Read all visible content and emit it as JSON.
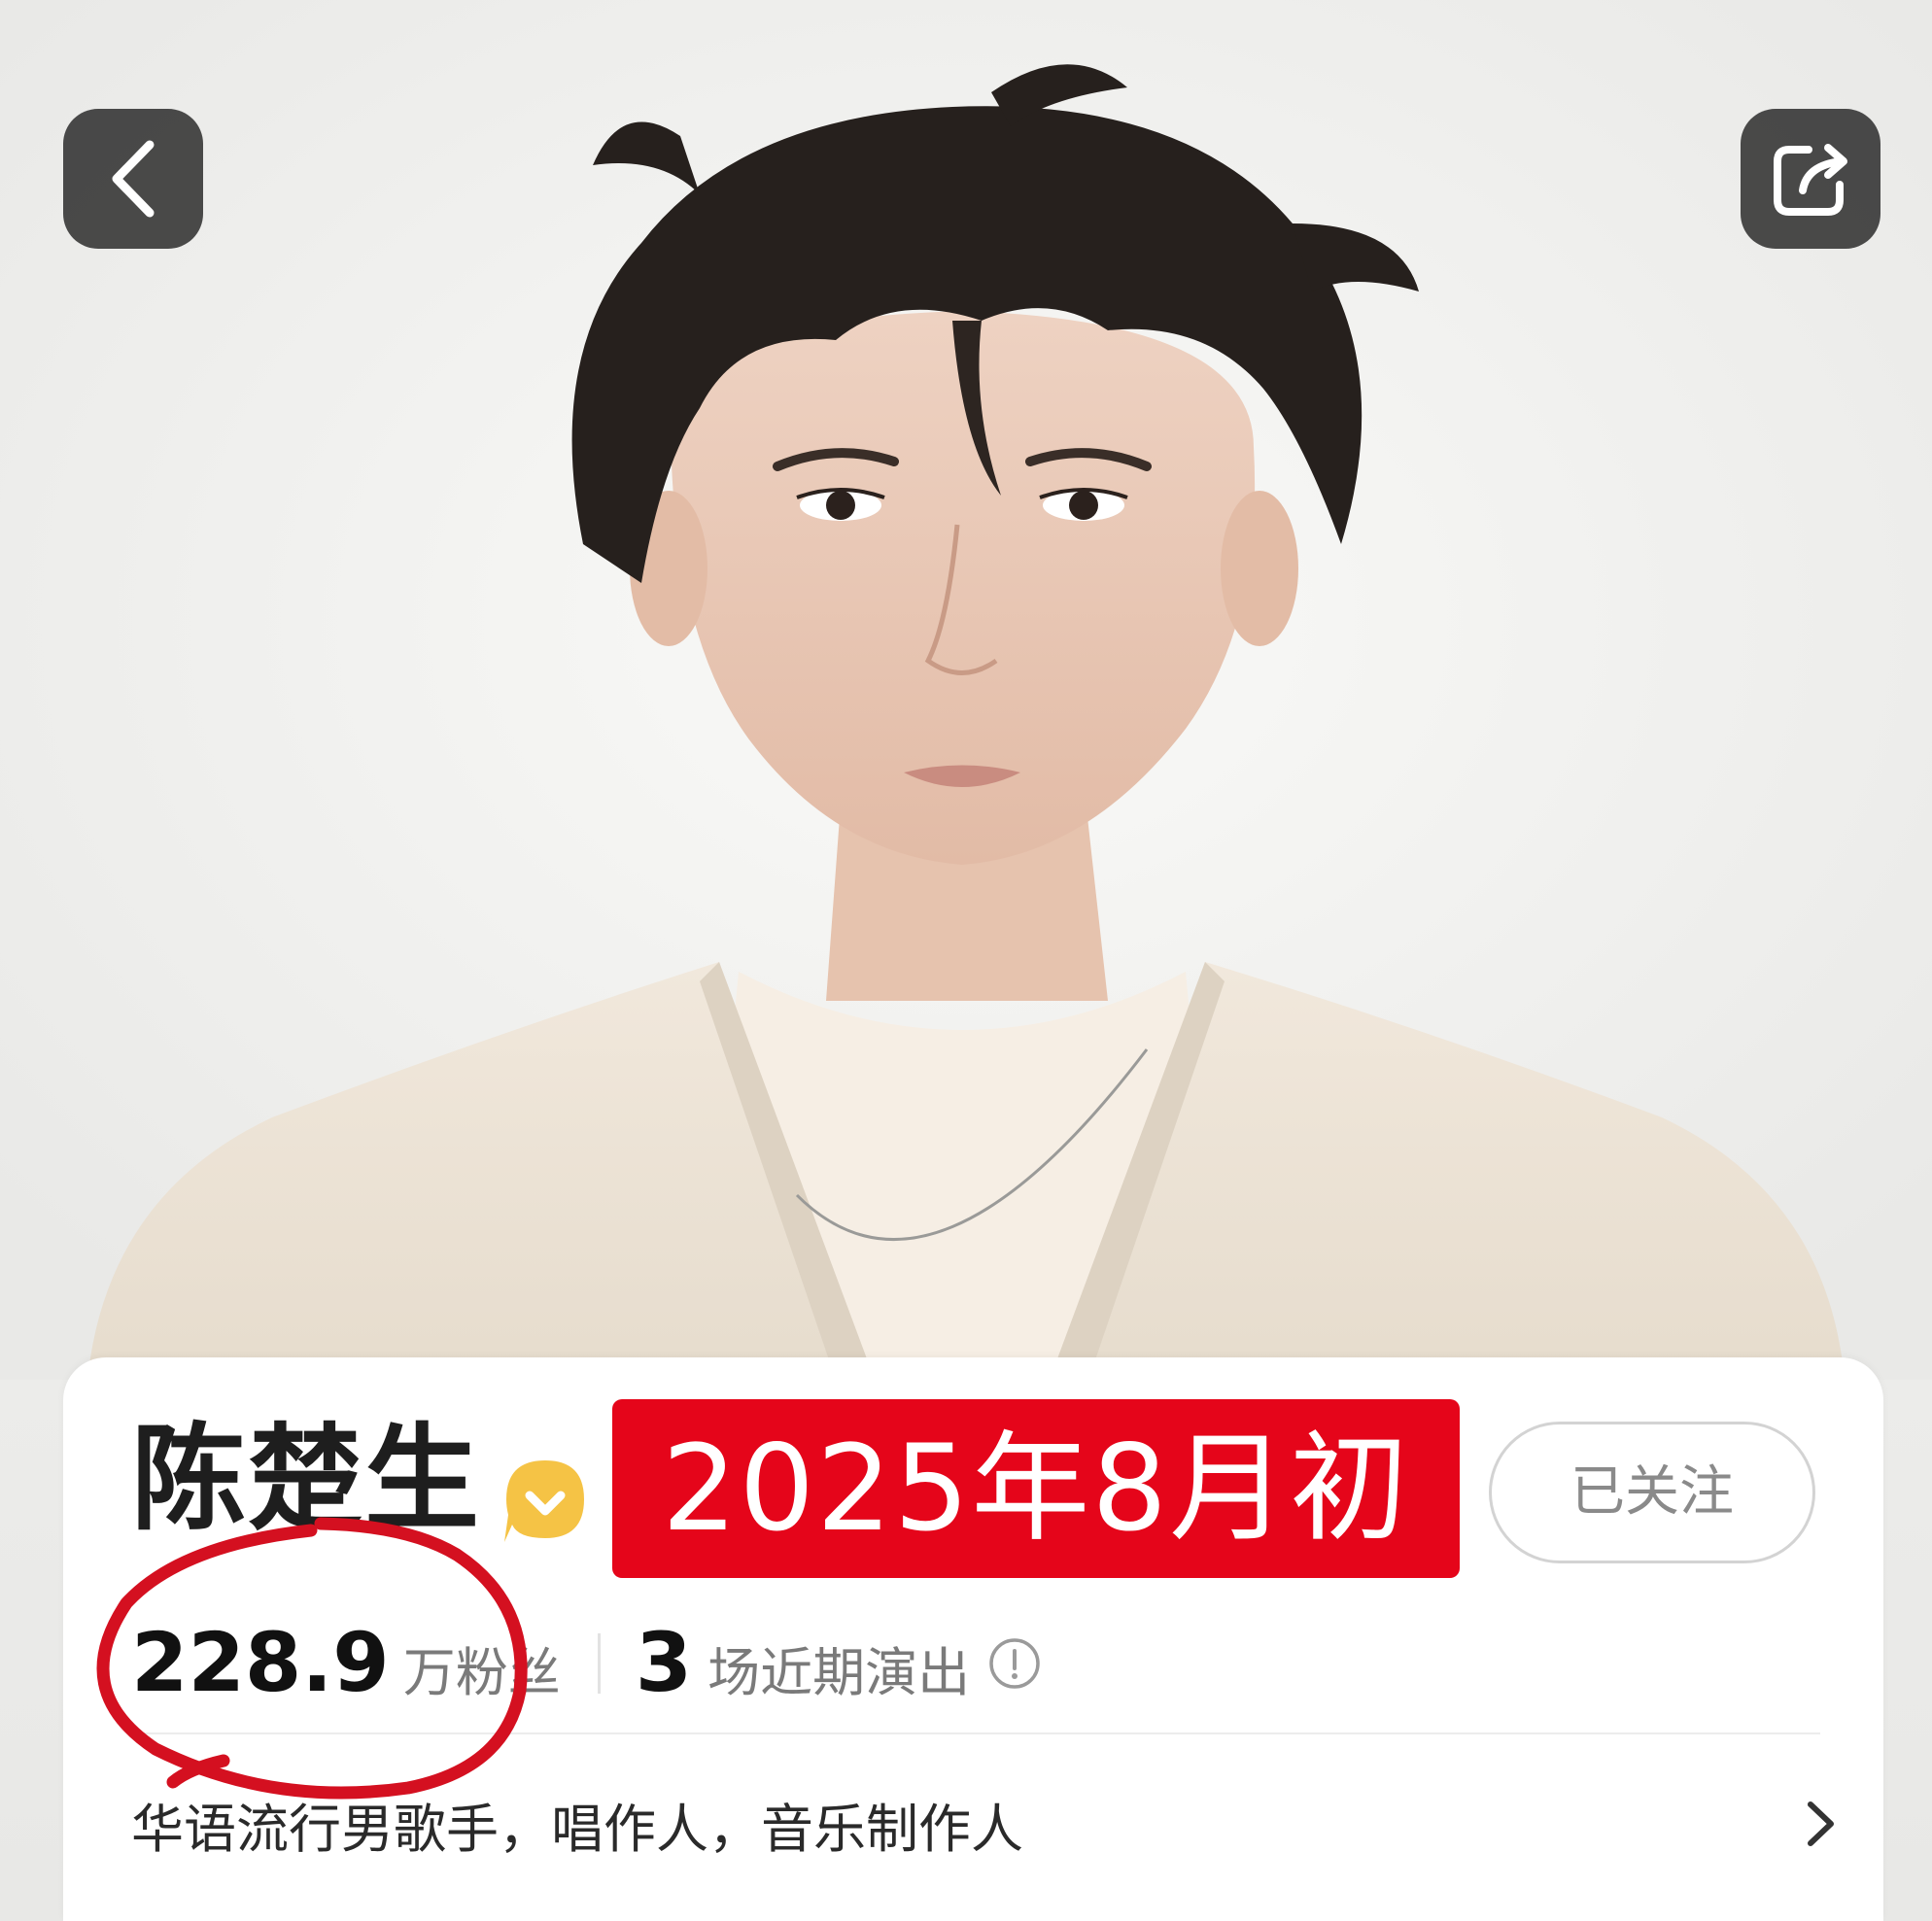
{
  "header": {
    "back_icon": "chevron-left-icon",
    "share_icon": "share-icon"
  },
  "profile": {
    "name": "陈楚生",
    "verified_icon": "verified-badge-icon",
    "date_banner": "2025年8月初",
    "follow_button": "已关注",
    "fans_count": "228.9",
    "fans_label": "万粉丝",
    "shows_count": "3",
    "shows_label": "场近期演出",
    "info_icon": "info-icon",
    "bio": "华语流行男歌手，唱作人，音乐制作人",
    "bio_chevron_icon": "chevron-right-icon"
  },
  "colors": {
    "banner_red": "#e5051a",
    "annotation_red": "#d41020",
    "verified_yellow": "#f5c345"
  }
}
